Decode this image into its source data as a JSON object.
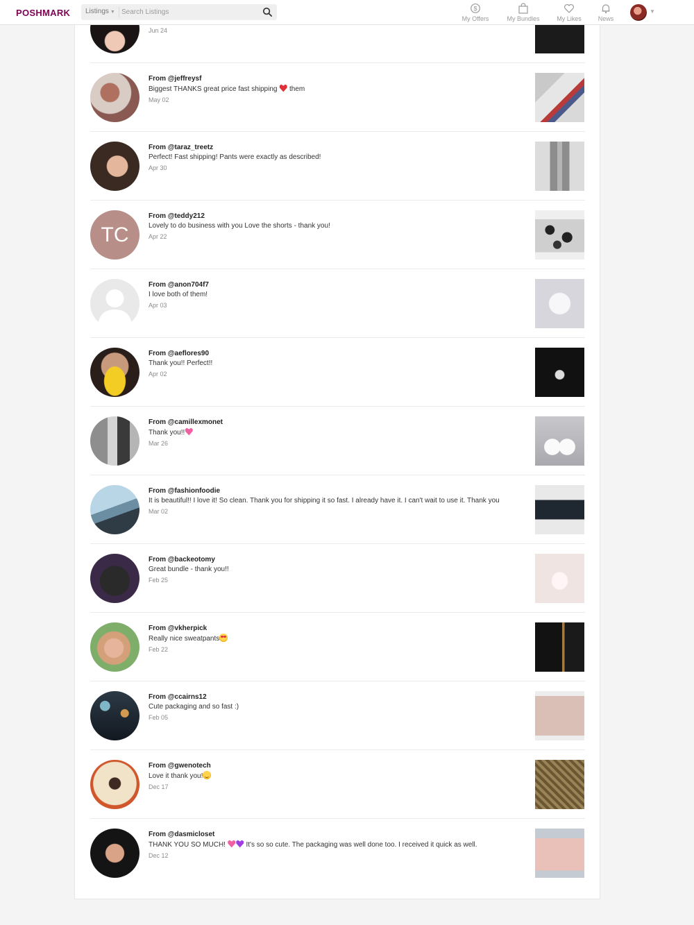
{
  "header": {
    "logo": "POSHMARK",
    "search_scope": "Listings",
    "search_placeholder": "Search Listings",
    "nav": [
      {
        "label": "My Offers",
        "icon": "dollar-circle-icon"
      },
      {
        "label": "My Bundles",
        "icon": "bag-icon"
      },
      {
        "label": "My Likes",
        "icon": "heart-outline-icon"
      },
      {
        "label": "News",
        "icon": "bell-icon"
      }
    ]
  },
  "colors": {
    "brand": "#7f0353",
    "tc_avatar": "#b88f88"
  },
  "reviews": [
    {
      "date": "Jun 24"
    },
    {
      "from": "From @jeffreysf",
      "message": "Biggest THANKS great price fast shipping",
      "message_after": "them",
      "emoji": "red-heart",
      "date": "May 02"
    },
    {
      "from": "From @taraz_treetz",
      "message": "Perfect! Fast shipping! Pants were exactly as described!",
      "date": "Apr 30"
    },
    {
      "from": "From @teddy212",
      "message": "Lovely to do business with you Love the shorts - thank you!",
      "date": "Apr 22",
      "initials": "TC"
    },
    {
      "from": "From @anon704f7",
      "message": "I love both of them!",
      "date": "Apr 03"
    },
    {
      "from": "From @aeflores90",
      "message": "Thank you!! Perfect!!",
      "date": "Apr 02"
    },
    {
      "from": "From @camillexmonet",
      "message": "Thank you!!",
      "emoji": "pink-heart",
      "date": "Mar 26"
    },
    {
      "from": "From @fashionfoodie",
      "message": "It is beautiful!! I love it! So clean. Thank you for shipping it so fast. I already have it. I can't wait to use it. Thank you",
      "date": "Mar 02"
    },
    {
      "from": "From @backeotomy",
      "message": "Great bundle - thank you!!",
      "date": "Feb 25"
    },
    {
      "from": "From @vkherpick",
      "message": "Really nice sweatpants",
      "emoji": "heart-eyes-face",
      "date": "Feb 22"
    },
    {
      "from": "From @ccairns12",
      "message": "Cute packaging and so fast :)",
      "date": "Feb 05"
    },
    {
      "from": "From @gwenotech",
      "message": "Love it thank you!",
      "emoji": "smiling-face",
      "date": "Dec 17"
    },
    {
      "from": "From @dasmicloset",
      "message": "THANK YOU SO MUCH!",
      "message_after": "It's so so cute. The packaging was well done too. I received it quick as well.",
      "emoji": "pink-and-purple-hearts",
      "date": "Dec 12"
    }
  ]
}
